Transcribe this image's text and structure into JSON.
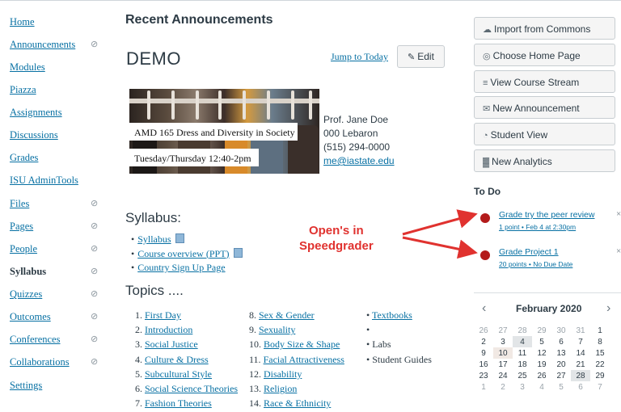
{
  "sidebar": {
    "items": [
      {
        "label": "Home",
        "hidden": false,
        "active": false
      },
      {
        "label": "Announcements",
        "hidden": true,
        "active": false
      },
      {
        "label": "Modules",
        "hidden": false,
        "active": false
      },
      {
        "label": "Piazza",
        "hidden": false,
        "active": false
      },
      {
        "label": "Assignments",
        "hidden": false,
        "active": false
      },
      {
        "label": "Discussions",
        "hidden": false,
        "active": false
      },
      {
        "label": "Grades",
        "hidden": false,
        "active": false
      },
      {
        "label": "ISU AdminTools",
        "hidden": false,
        "active": false
      },
      {
        "label": "Files",
        "hidden": true,
        "active": false
      },
      {
        "label": "Pages",
        "hidden": true,
        "active": false
      },
      {
        "label": "People",
        "hidden": true,
        "active": false
      },
      {
        "label": "Syllabus",
        "hidden": true,
        "active": true
      },
      {
        "label": "Quizzes",
        "hidden": true,
        "active": false
      },
      {
        "label": "Outcomes",
        "hidden": true,
        "active": false
      },
      {
        "label": "Conferences",
        "hidden": true,
        "active": false
      },
      {
        "label": "Collaborations",
        "hidden": true,
        "active": false
      },
      {
        "label": "Settings",
        "hidden": false,
        "active": false
      }
    ]
  },
  "main": {
    "recent_heading": "Recent Announcements",
    "course_title": "DEMO",
    "jump_label": "Jump to Today",
    "edit_label": "Edit",
    "banner_line1": "AMD 165 Dress and Diversity in Society",
    "banner_line2": "Tuesday/Thursday 12:40-2pm",
    "prof_name": "Prof. Jane Doe",
    "prof_office": "000 Lebaron",
    "prof_phone": "(515) 294-0000",
    "prof_email": "me@iastate.edu",
    "syllabus_heading": "Syllabus:",
    "syllabus_links": [
      "Syllabus",
      "Course overview (PPT)",
      "Country Sign Up Page"
    ],
    "topics_heading": "Topics ....",
    "topics_col1": [
      {
        "num": "1.",
        "label": "First Day"
      },
      {
        "num": "2.",
        "label": "Introduction"
      },
      {
        "num": "3.",
        "label": "Social Justice"
      },
      {
        "num": "4.",
        "label": "Culture & Dress"
      },
      {
        "num": "5.",
        "label": "Subcultural Style"
      },
      {
        "num": "6.",
        "label": "Social Science Theories"
      },
      {
        "num": "7.",
        "label": "Fashion Theories"
      }
    ],
    "topics_col2": [
      {
        "num": "8.",
        "label": "Sex & Gender"
      },
      {
        "num": "9.",
        "label": "Sexuality"
      },
      {
        "num": "10.",
        "label": "Body Size & Shape"
      },
      {
        "num": "11.",
        "label": "Facial Attractiveness"
      },
      {
        "num": "12.",
        "label": "Disability"
      },
      {
        "num": "13.",
        "label": "Religion"
      },
      {
        "num": "14.",
        "label": "Race & Ethnicity"
      }
    ],
    "topics_col3": [
      "Textbooks",
      "",
      "Labs",
      "Student Guides"
    ]
  },
  "right": {
    "buttons": [
      {
        "label": "Import from Commons",
        "icon": "commons-icon",
        "glyph": "☁"
      },
      {
        "label": "Choose Home Page",
        "icon": "home-page-icon",
        "glyph": "◎"
      },
      {
        "label": "View Course Stream",
        "icon": "stream-icon",
        "glyph": "≡"
      },
      {
        "label": "New Announcement",
        "icon": "announcement-icon",
        "glyph": "✉"
      },
      {
        "label": "Student View",
        "icon": "student-view-icon",
        "glyph": "◔"
      },
      {
        "label": "New Analytics",
        "icon": "analytics-icon",
        "glyph": "▓"
      }
    ],
    "todo_heading": "To Do",
    "todos": [
      {
        "badge": "2",
        "title": "Grade try the peer review",
        "meta": "1 point • Feb 4 at 2:30pm"
      },
      {
        "badge": "1",
        "title": "Grade Project 1",
        "meta": "20 points • No Due Date"
      }
    ],
    "calendar": {
      "month": "February 2020",
      "weeks": [
        [
          "26",
          "27",
          "28",
          "29",
          "30",
          "31",
          "1"
        ],
        [
          "2",
          "3",
          "4",
          "5",
          "6",
          "7",
          "8"
        ],
        [
          "9",
          "10",
          "11",
          "12",
          "13",
          "14",
          "15"
        ],
        [
          "16",
          "17",
          "18",
          "19",
          "20",
          "21",
          "22"
        ],
        [
          "23",
          "24",
          "25",
          "26",
          "27",
          "28",
          "29"
        ],
        [
          "1",
          "2",
          "3",
          "4",
          "5",
          "6",
          "7"
        ]
      ]
    }
  },
  "annotation": {
    "line1": "Open's in",
    "line2": "Speedgrader",
    "color": "#e0322f"
  },
  "colors": {
    "link": "#0770a3",
    "text": "#2d3b45",
    "badge": "#b31b1b"
  }
}
